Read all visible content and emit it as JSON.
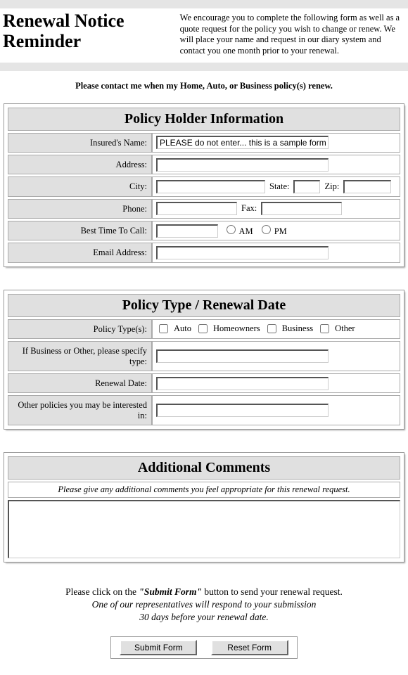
{
  "header": {
    "title": "Renewal Notice Reminder",
    "description": "We encourage you to complete the following form as well as a quote request for the policy you wish to change or renew. We will place your name and request in our diary system and contact you one month prior to your renewal."
  },
  "sub_instruction": "Please contact me when my Home, Auto, or Business policy(s) renew.",
  "section1": {
    "heading": "Policy Holder Information",
    "labels": {
      "insured_name": "Insured's Name:",
      "address": "Address:",
      "city": "City:",
      "state": "State:",
      "zip": "Zip:",
      "phone": "Phone:",
      "fax": "Fax:",
      "best_time": "Best Time To Call:",
      "am": "AM",
      "pm": "PM",
      "email": "Email Address:"
    },
    "values": {
      "insured_name": "PLEASE do not enter... this is a sample form",
      "address": "",
      "city": "",
      "state": "",
      "zip": "",
      "phone": "",
      "fax": "",
      "best_time": "",
      "email": ""
    }
  },
  "section2": {
    "heading": "Policy Type / Renewal Date",
    "labels": {
      "policy_types": "Policy Type(s):",
      "auto": "Auto",
      "homeowners": "Homeowners",
      "business": "Business",
      "other": "Other",
      "specify": "If Business or Other, please specify type:",
      "renewal_date": "Renewal Date:",
      "other_policies": "Other policies you may be interested in:"
    },
    "values": {
      "specify": "",
      "renewal_date": "",
      "other_policies": ""
    }
  },
  "section3": {
    "heading": "Additional Comments",
    "instruction": "Please give any additional comments you feel appropriate for this renewal request.",
    "value": ""
  },
  "footer": {
    "line1_pre": "Please click on the ",
    "line1_bold": "\"Submit Form\"",
    "line1_post": " button to send your renewal request.",
    "line2": "One of our representatives will respond to your submission",
    "line3": "30 days before your renewal date."
  },
  "buttons": {
    "submit": "Submit Form",
    "reset": "Reset Form"
  }
}
